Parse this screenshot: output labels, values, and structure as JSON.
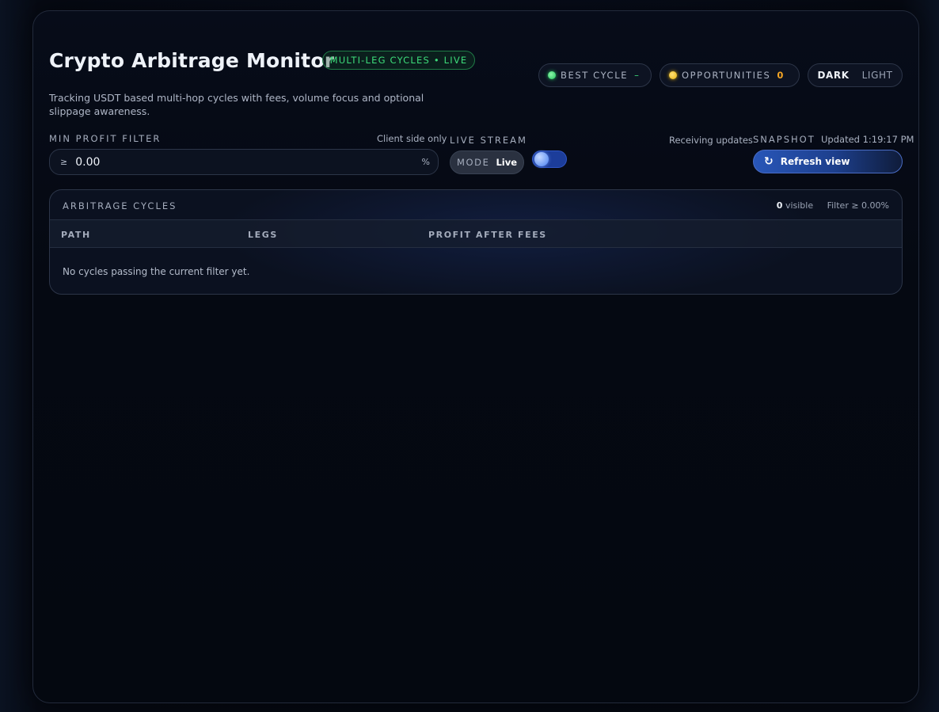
{
  "header": {
    "title": "Crypto Arbitrage Monitor",
    "badge": "MULTI-LEG CYCLES • LIVE",
    "subtitle": "Tracking USDT based multi-hop cycles with fees, volume focus and optional slippage awareness."
  },
  "status": {
    "best_cycle_label": "BEST CYCLE",
    "best_cycle_value": "–",
    "opportunities_label": "OPPORTUNITIES",
    "opportunities_value": "0"
  },
  "theme": {
    "dark": "DARK",
    "light": "LIGHT",
    "selected": "DARK"
  },
  "filter": {
    "label": "MIN PROFIT FILTER",
    "hint": "Client side only",
    "prefix": "≥",
    "value": "0.00",
    "unit": "%"
  },
  "live": {
    "label": "LIVE STREAM",
    "mode_label": "MODE",
    "mode_value": "Live",
    "status": "Receiving updates",
    "enabled": true
  },
  "snapshot": {
    "label": "SNAPSHOT",
    "updated": "Updated 1:19:17 PM",
    "refresh_icon": "↻",
    "refresh_label": "Refresh view"
  },
  "table": {
    "title": "ARBITRAGE CYCLES",
    "visible_count": "0",
    "visible_label": "visible",
    "filter_label": "Filter ≥ 0.00%",
    "columns": [
      "PATH",
      "LEGS",
      "PROFIT AFTER FEES"
    ],
    "rows": [],
    "empty_message": "No cycles passing the current filter yet."
  },
  "colors": {
    "accent_green": "#3ddc7a",
    "accent_yellow": "#f5a524",
    "accent_blue": "#2856b8",
    "background": "#050912"
  }
}
